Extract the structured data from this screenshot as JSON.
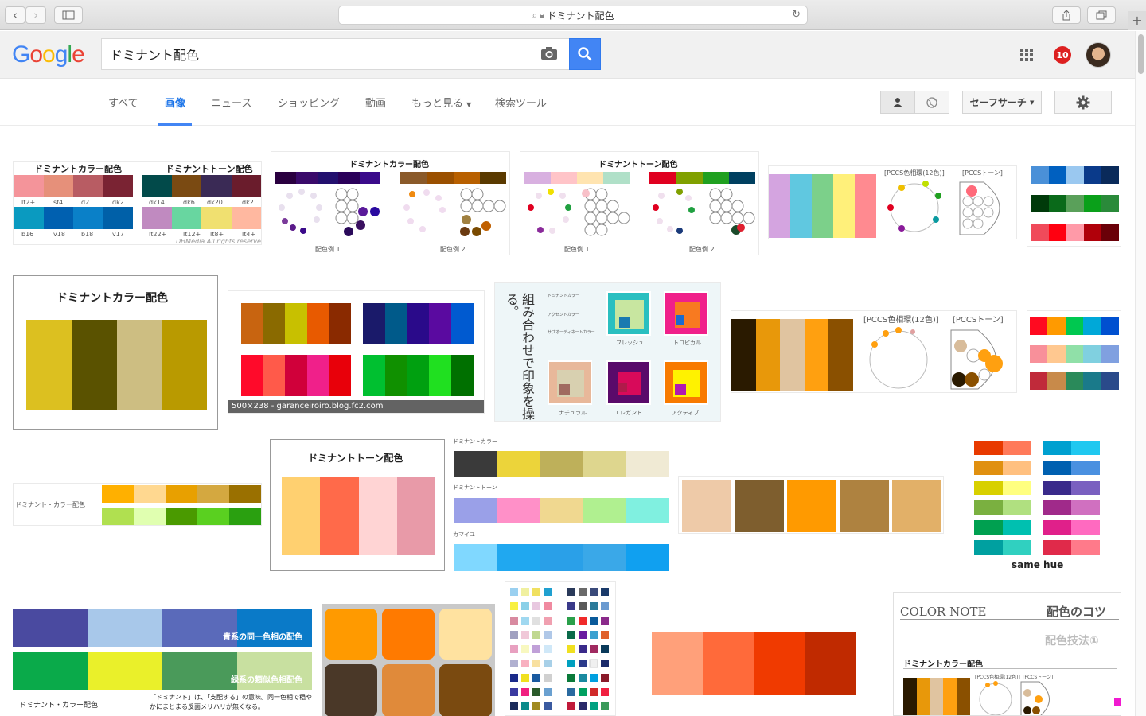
{
  "browser": {
    "url_text": "ドミナント配色",
    "icons": [
      "back-icon",
      "forward-icon",
      "sidebar-icon",
      "search-icon",
      "lock-icon",
      "reload-icon",
      "share-icon",
      "tabs-icon",
      "new-tab-icon"
    ]
  },
  "search": {
    "query": "ドミナント配色"
  },
  "header": {
    "notifications": "10",
    "accent": "#4285f4"
  },
  "tabs": [
    {
      "label": "すべて"
    },
    {
      "label": "画像"
    },
    {
      "label": "ニュース"
    },
    {
      "label": "ショッピング"
    },
    {
      "label": "動画"
    },
    {
      "label": "もっと見る"
    },
    {
      "label": "検索ツール"
    }
  ],
  "tools": {
    "safesearch": "セーフサーチ"
  },
  "results": {
    "r1": {
      "title_a": "ドミナントカラー配色",
      "title_b": "ドミナントトーン配色",
      "labels_a": [
        "lt2+",
        "sf4",
        "d2",
        "dk2",
        "b16",
        "v18",
        "b18",
        "v17"
      ],
      "labels_b": [
        "dk14",
        "dk6",
        "dk20",
        "dk2",
        "lt22+",
        "lt12+",
        "lt8+",
        "lt4+"
      ],
      "credit": "DHMedia All rights reserved"
    },
    "r2": {
      "title": "ドミナントカラー配色",
      "cap_a": "配色例 1",
      "cap_b": "配色例 2"
    },
    "r3": {
      "title": "ドミナントトーン配色",
      "cap_a": "配色例 1",
      "cap_b": "配色例 2"
    },
    "r4": {
      "label_a": "[PCCS色相環(12色)]",
      "label_b": "[PCCSトーン]"
    },
    "r6": {
      "title": "ドミナントカラー配色"
    },
    "r7": {
      "overlay": "500×238 - garanceiroiro.blog.fc2.com"
    },
    "r8": {
      "vertical": "組み合わせで印象を操る。",
      "lines": [
        "ドミナントカラー",
        "アクセントカラー",
        "サブオーディネートカラー"
      ],
      "names": [
        "フレッシュ",
        "トロピカル",
        "ナチュラル",
        "エレガント",
        "アクティブ"
      ]
    },
    "r9": {
      "label_a": "[PCCS色相環(12色)]",
      "label_b": "[PCCSトーン]"
    },
    "r11": {
      "label": "ドミナント・カラー配色"
    },
    "r12": {
      "title": "ドミナントトーン配色"
    },
    "r13": {
      "labels": [
        "ドミナントカラー",
        "ドミナントトーン",
        "カマイユ"
      ]
    },
    "r15": {
      "caption": "same hue"
    },
    "r16": {
      "label_a": "青系の同一色相の配色",
      "label_b": "緑系の類似色相配色",
      "caption": "ドミナント・カラー配色",
      "note": "「ドミナント」は、「支配する」の意味。同一色相で穏やかにまとまる反面メリハリが無くなる。"
    },
    "r20": {
      "brand": "COLOR NOTE",
      "heading": "配色のコツ",
      "sub": "配色技法①",
      "title": "ドミナントカラー配色",
      "label_a": "[PCCS色相環(12色)]",
      "label_b": "[PCCSトーン]"
    }
  }
}
